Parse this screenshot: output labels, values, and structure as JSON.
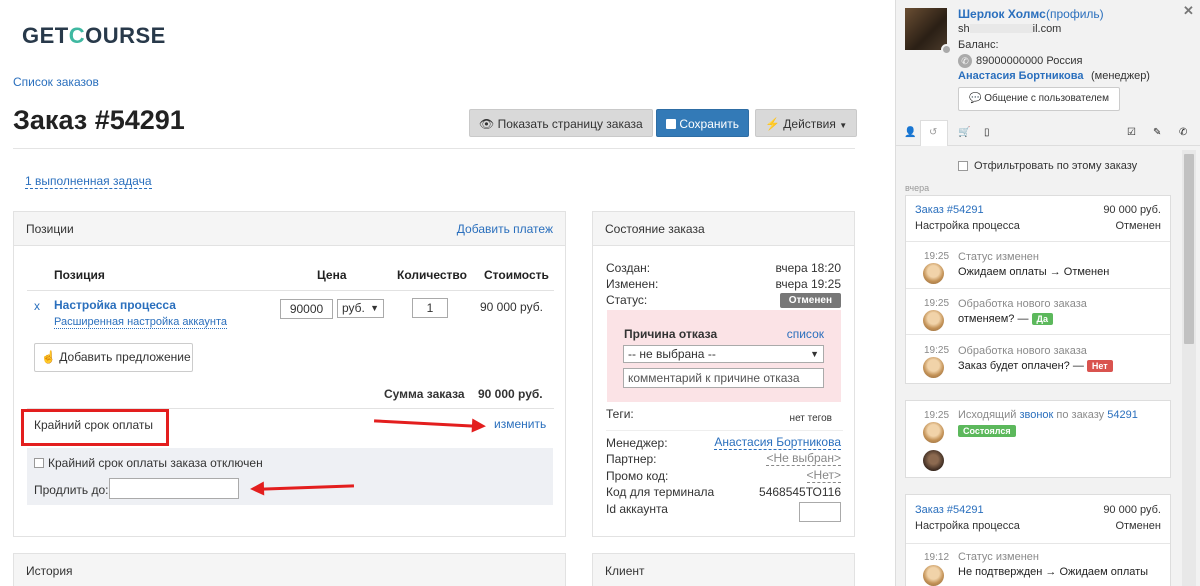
{
  "logo": {
    "part1": "GET",
    "part2": "C",
    "part3": "OURSE"
  },
  "breadcrumb": "Список заказов",
  "title": "Заказ #54291",
  "buttons": {
    "show_page": "Показать страницу заказа",
    "save": "Сохранить",
    "actions": "Действия"
  },
  "task_link": "1 выполненная задача",
  "positions": {
    "header": "Позиции",
    "add_payment": "Добавить платеж",
    "columns": [
      "Позиция",
      "Цена",
      "Количество",
      "Стоимость"
    ],
    "remove": "x",
    "item_name": "Настройка процесса",
    "item_sub": "Расширенная настройка аккаунта",
    "price": "90000",
    "currency": "руб.",
    "qty": "1",
    "cost": "90 000 руб.",
    "add_offer": "Добавить предложение",
    "sum_label": "Сумма заказа",
    "sum_value": "90 000 руб.",
    "deadline_label": "Крайний срок оплаты",
    "change": "изменить",
    "deadline_disabled": "Крайний срок оплаты заказа отключен",
    "extend_label": "Продлить до:",
    "extend_value": ""
  },
  "state": {
    "header": "Состояние заказа",
    "created_label": "Создан:",
    "created_value": "вчера 18:20",
    "changed_label": "Изменен:",
    "changed_value": "вчера 19:25",
    "status_label": "Статус:",
    "status_value": "Отменен",
    "reason_label": "Причина отказа",
    "reason_list": "список",
    "reason_select": "-- не выбрана --",
    "reason_comment_placeholder": "комментарий к причине отказа",
    "tags_label": "Теги:",
    "tags_value": "нет тегов",
    "manager_label": "Менеджер:",
    "manager_value": "Анастасия Бортникова",
    "partner_label": "Партнер:",
    "partner_value": "<Не выбран>",
    "promo_label": "Промо код:",
    "promo_value": "<Нет>",
    "terminal_label": "Код для терминала",
    "terminal_value": "5468545ТО116",
    "account_label": "Id аккаунта",
    "account_value": ""
  },
  "history": {
    "header": "История"
  },
  "client": {
    "header": "Клиент"
  },
  "sidebar": {
    "user_name": "Шерлок Холмс",
    "profile": "(профиль)",
    "email_start": "sh",
    "email_end": "il.com",
    "balance": "Баланс:",
    "phone": "89000000000 Россия",
    "manager": "Анастасия Бортникова",
    "manager_role": "(менеджер)",
    "chat_button": "Общение с пользователем",
    "filter_label": "Отфильтровать по этому заказу",
    "day_label": "вчера",
    "card1": {
      "order": "Заказ #54291",
      "amount": "90 000 руб.",
      "product": "Настройка процесса",
      "status": "Отменен",
      "events": [
        {
          "time": "19:25",
          "title": "Статус изменен",
          "text": "Ожидаем оплаты → Отменен",
          "badge": ""
        },
        {
          "time": "19:25",
          "title": "Обработка нового заказа",
          "text": "отменяем? —",
          "badge": "Да"
        },
        {
          "time": "19:25",
          "title": "Обработка нового заказа",
          "text": "Заказ будет оплачен? —",
          "badge": "Нет"
        }
      ]
    },
    "call": {
      "time": "19:25",
      "text1": "Исходящий",
      "link1": "звонок",
      "text2": "по заказу",
      "link2": "54291",
      "badge": "Состоялся"
    },
    "card2": {
      "order": "Заказ #54291",
      "amount": "90 000 руб.",
      "product": "Настройка процесса",
      "status": "Отменен",
      "event": {
        "time": "19:12",
        "title": "Статус изменен",
        "text": "Не подтвержден → Ожидаем оплаты"
      }
    }
  },
  "colors": {
    "accent": "#2a6fbd",
    "save": "#337ab7",
    "status_cancel": "#777777",
    "yes": "#5cb85c",
    "no": "#d9534f",
    "annotation": "#e31e1e"
  }
}
